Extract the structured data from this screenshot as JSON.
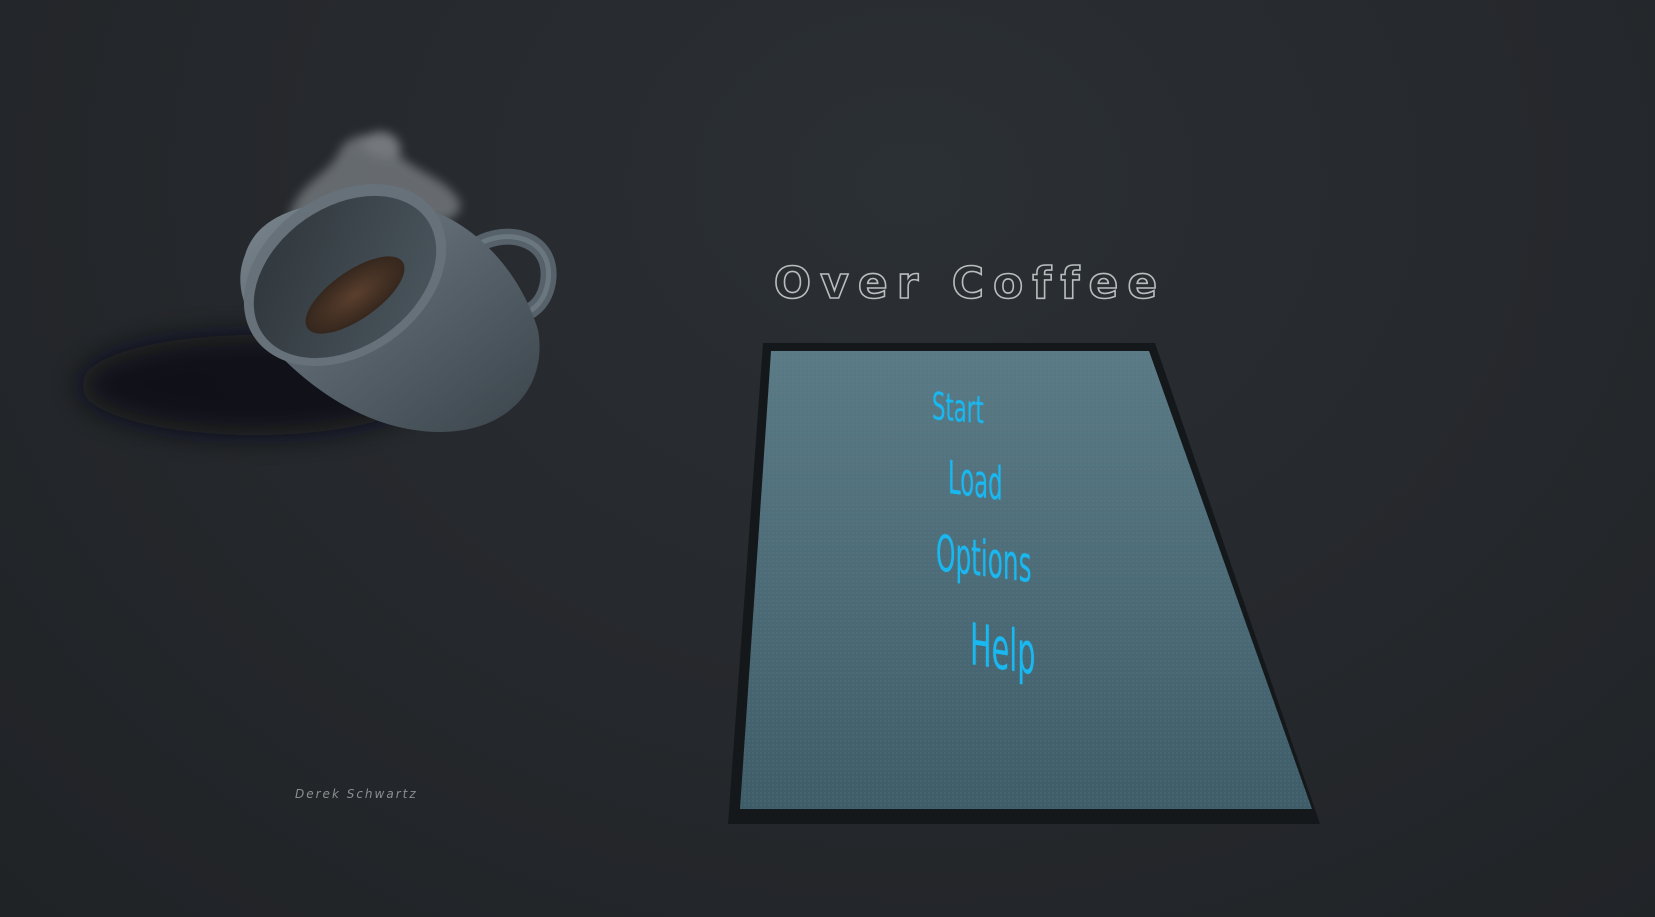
{
  "game": {
    "title": "Over Coffee",
    "credit": "Derek Schwartz"
  },
  "menu": {
    "items": [
      {
        "id": "start",
        "label": "Start"
      },
      {
        "id": "load",
        "label": "Load"
      },
      {
        "id": "options",
        "label": "Options"
      },
      {
        "id": "help",
        "label": "Help"
      }
    ],
    "text_color": "#19b8f0",
    "board_color": "#4a6a76"
  },
  "scene": {
    "table_color": "#26292d",
    "cup_color": "#5a6670",
    "coffee_color": "#3a2a20",
    "objects": [
      "coffee-cup-icon",
      "steam-icon"
    ]
  }
}
